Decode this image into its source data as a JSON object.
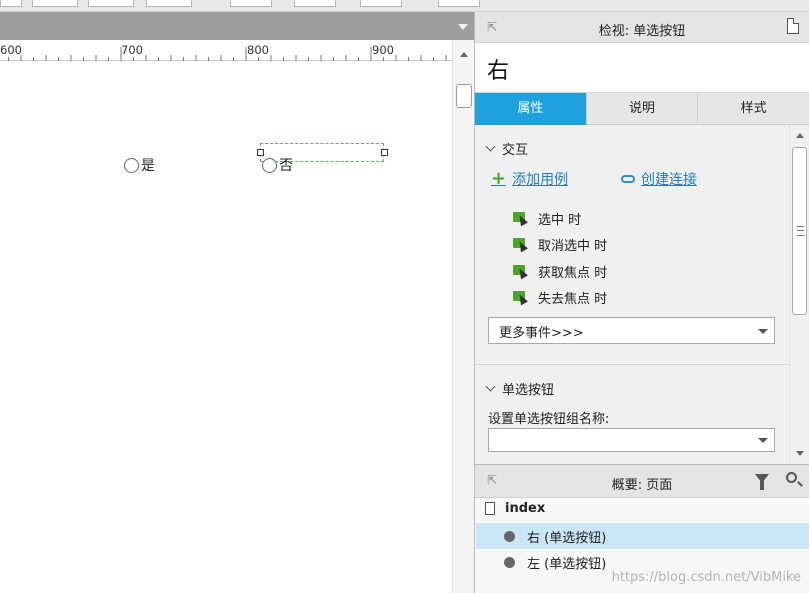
{
  "ruler": {
    "labels": [
      "600",
      "700",
      "800",
      "900"
    ]
  },
  "canvas": {
    "radio_yes_label": "是",
    "radio_no_label": "否"
  },
  "inspector": {
    "title": "检视: 单选按钮",
    "widget_name": "右",
    "tabs": [
      {
        "label": "属性",
        "active": true
      },
      {
        "label": "说明",
        "active": false
      },
      {
        "label": "样式",
        "active": false
      }
    ],
    "interaction": {
      "section_title": "交互",
      "add_case_label": "添加用例",
      "create_link_label": "创建连接",
      "events": [
        "选中 时",
        "取消选中 时",
        "获取焦点 时",
        "失去焦点 时"
      ],
      "more_events_label": "更多事件>>>"
    },
    "radio_section": {
      "section_title": "单选按钮",
      "group_name_label": "设置单选按钮组名称:",
      "group_name_value": ""
    }
  },
  "outline": {
    "title": "概要: 页面",
    "root": "index",
    "items": [
      {
        "label": "右 (单选按钮)",
        "selected": true
      },
      {
        "label": "左 (单选按钮)",
        "selected": false
      }
    ]
  },
  "watermark": "https://blog.csdn.net/VibMike",
  "colors": {
    "accent": "#1ea1dc",
    "selection": "#3ec43e",
    "link": "#1d7fc2",
    "event_icon": "#4aa628"
  }
}
